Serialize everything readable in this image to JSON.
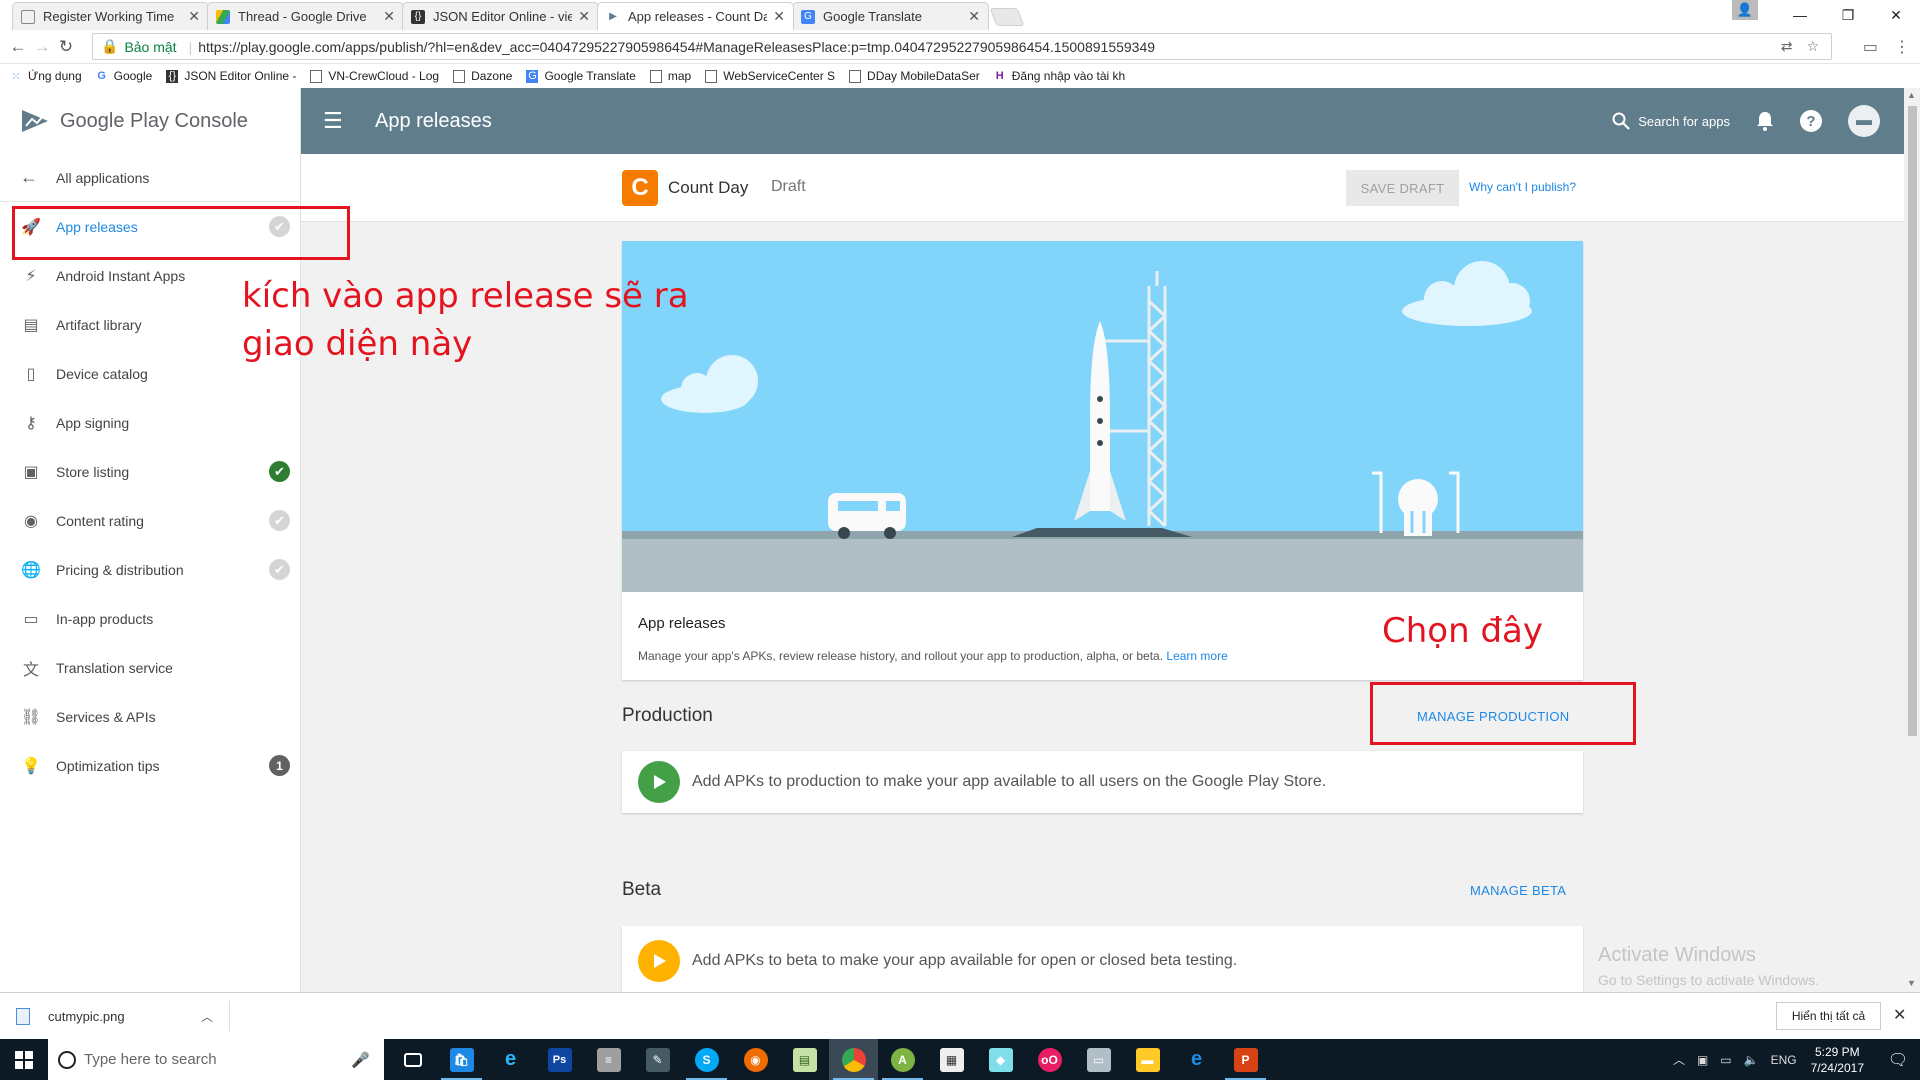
{
  "browser": {
    "tabs": [
      {
        "title": "Register Working Time",
        "active": false,
        "icon": "page-icon"
      },
      {
        "title": "Thread - Google Drive",
        "active": false,
        "icon": "drive-icon"
      },
      {
        "title": "JSON Editor Online - vie",
        "active": false,
        "icon": "json-icon"
      },
      {
        "title": "App releases - Count Da",
        "active": true,
        "icon": "play-console-icon"
      },
      {
        "title": "Google Translate",
        "active": false,
        "icon": "translate-icon"
      }
    ],
    "secure_label": "Bảo mật",
    "url": "https://play.google.com/apps/publish/?hl=en&dev_acc=04047295227905986454#ManageReleasesPlace:p=tmp.04047295227905986454.1500891559349",
    "bookmarks": [
      {
        "label": "Ứng dụng",
        "icon": "apps-grid-icon"
      },
      {
        "label": "Google",
        "icon": "google-icon"
      },
      {
        "label": "JSON Editor Online -",
        "icon": "json-icon"
      },
      {
        "label": "VN-CrewCloud - Log",
        "icon": "page-icon"
      },
      {
        "label": "Dazone",
        "icon": "page-icon"
      },
      {
        "label": "Google Translate",
        "icon": "translate-icon"
      },
      {
        "label": "map",
        "icon": "page-icon"
      },
      {
        "label": "WebServiceCenter S",
        "icon": "page-icon"
      },
      {
        "label": "DDay MobileDataSer",
        "icon": "page-icon"
      },
      {
        "label": "Đăng nhập vào tài kh",
        "icon": "user-icon"
      }
    ]
  },
  "console": {
    "logo_text_1": "Google Play",
    "logo_text_2": "Console",
    "page_title": "App releases",
    "search_label": "Search for apps"
  },
  "sidebar": {
    "back_label": "All applications",
    "items": [
      {
        "label": "App releases",
        "icon": "rocket-icon",
        "status": "grey-check",
        "active": true
      },
      {
        "label": "Android Instant Apps",
        "icon": "bolt-icon",
        "status": "",
        "active": false
      },
      {
        "label": "Artifact library",
        "icon": "library-icon",
        "status": "",
        "active": false
      },
      {
        "label": "Device catalog",
        "icon": "device-icon",
        "status": "",
        "active": false
      },
      {
        "label": "App signing",
        "icon": "key-icon",
        "status": "",
        "active": false
      },
      {
        "label": "Store listing",
        "icon": "store-icon",
        "status": "green-check",
        "active": false
      },
      {
        "label": "Content rating",
        "icon": "rating-icon",
        "status": "grey-check",
        "active": false
      },
      {
        "label": "Pricing & distribution",
        "icon": "globe-icon",
        "status": "grey-check",
        "active": false
      },
      {
        "label": "In-app products",
        "icon": "card-icon",
        "status": "",
        "active": false
      },
      {
        "label": "Translation service",
        "icon": "translate-icon",
        "status": "",
        "active": false
      },
      {
        "label": "Services & APIs",
        "icon": "api-icon",
        "status": "",
        "active": false
      },
      {
        "label": "Optimization tips",
        "icon": "bulb-icon",
        "status": "1",
        "active": false
      }
    ]
  },
  "app": {
    "icon_letter": "C",
    "name": "Count Day",
    "status": "Draft",
    "save_draft": "SAVE DRAFT",
    "why_link": "Why can't I publish?"
  },
  "release_card": {
    "title": "App releases",
    "description": "Manage your app's APKs, review release history, and rollout your app to production, alpha, or beta.",
    "learn_more": "Learn more"
  },
  "production": {
    "title": "Production",
    "manage": "MANAGE PRODUCTION",
    "text": "Add APKs to production to make your app available to all users on the Google Play Store.",
    "color": "#43a047"
  },
  "beta": {
    "title": "Beta",
    "manage": "MANAGE BETA",
    "text": "Add APKs to beta to make your app available for open or closed beta testing.",
    "color": "#ffb300"
  },
  "annotations": {
    "note_1_line_1": "kích vào app release sẽ ra",
    "note_1_line_2": "giao diện này",
    "note_2": "Chọn đây",
    "color": "#e3141f"
  },
  "watermark": {
    "line_1": "Activate Windows",
    "line_2": "Go to Settings to activate Windows."
  },
  "download_shelf": {
    "file": "cutmypic.png",
    "show_all": "Hiển thị tất cả"
  },
  "taskbar": {
    "search_placeholder": "Type here to search",
    "apps": [
      "task-view",
      "store",
      "edge-ie",
      "photoshop",
      "database",
      "paint-tool",
      "skype",
      "firefox",
      "notepad",
      "chrome",
      "android-studio",
      "calculator",
      "shape-app",
      "netbeans",
      "remote",
      "explorer",
      "edge",
      "powerpoint"
    ],
    "language": "ENG",
    "time": "5:29 PM",
    "date": "7/24/2017"
  }
}
